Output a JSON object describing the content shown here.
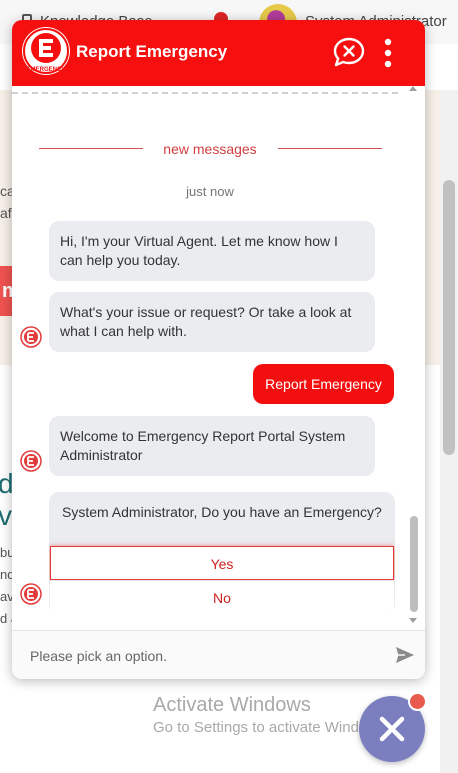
{
  "background_page": {
    "tab_label": "Knowledge Base",
    "user_name": "System Administrator",
    "hero_fragments": [
      "ca",
      "afe"
    ],
    "hero_button_letter": "m",
    "big_letters": [
      "d",
      "v"
    ],
    "body_fragments": [
      "bu",
      "nd",
      "av",
      "d a"
    ]
  },
  "windows_watermark": {
    "title": "Activate Windows",
    "subtitle": "Go to Settings to activate Windows."
  },
  "chat": {
    "title": "Report Emergency",
    "logo_text": "EMERGENCY",
    "divider_label": "new messages",
    "timestamp": "just now",
    "messages": [
      {
        "from": "agent",
        "text": "Hi, I'm your Virtual Agent. Let me know how I can help you today."
      },
      {
        "from": "agent",
        "text": "What's your issue or request? Or take a look at what I can help with."
      },
      {
        "from": "user",
        "text": "Report Emergency"
      },
      {
        "from": "agent",
        "text": "Welcome to Emergency Report Portal System Administrator"
      }
    ],
    "picker": {
      "prompt": "System Administrator, Do you have an Emergency?",
      "options": [
        "Yes",
        "No"
      ],
      "highlighted": "Yes"
    },
    "composer": {
      "placeholder": "Please pick an option.",
      "value": ""
    },
    "icons": {
      "end_chat": "end-chat-icon",
      "more": "more-vertical-icon",
      "send": "send-icon",
      "fab": "close-icon"
    },
    "colors": {
      "brand_red": "#f50f0f",
      "bubble_gray": "#eaecf0",
      "fab_purple": "#7b7fbf"
    }
  }
}
